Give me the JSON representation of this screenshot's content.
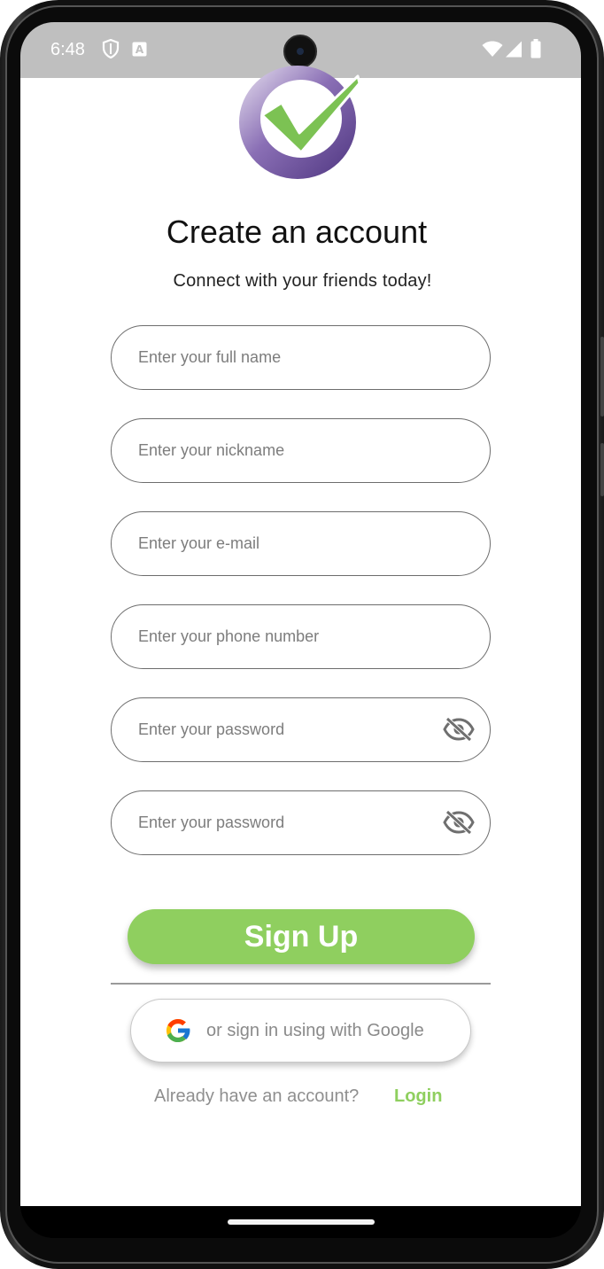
{
  "status_bar": {
    "time": "6:48"
  },
  "header": {
    "title": "Create an account",
    "subtitle": "Connect with your friends today!"
  },
  "form": {
    "full_name_placeholder": "Enter your full name",
    "nickname_placeholder": "Enter your nickname",
    "email_placeholder": "Enter your e-mail",
    "phone_placeholder": "Enter your phone number",
    "password_placeholder": "Enter your password",
    "confirm_password_placeholder": "Enter your password"
  },
  "actions": {
    "signup_label": "Sign Up",
    "google_label": "or sign in using with Google"
  },
  "footer": {
    "prompt": "Already have an account?",
    "login_label": "Login"
  },
  "icons": {
    "logo": "checkmark-logo-icon",
    "eye": "eye-off-icon",
    "google": "google-g-icon"
  },
  "colors": {
    "accent": "#8fcf5f",
    "logo_purple": "#6a4f96",
    "status_bar": "#bfbfbf"
  }
}
